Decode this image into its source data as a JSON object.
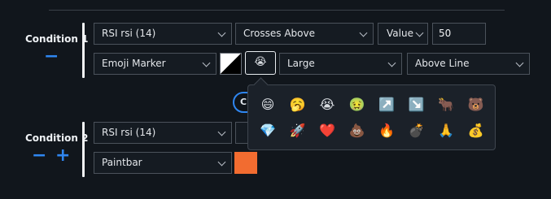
{
  "conditions": [
    {
      "label": "Condition 1",
      "ops": [
        "−"
      ],
      "indicator": "RSI rsi (14)",
      "operator": "Crosses Above",
      "value_type": "Value",
      "value": "50",
      "marker_type": "Emoji Marker",
      "selected_emoji": "😭",
      "size": "Large",
      "position": "Above Line"
    },
    {
      "label": "Condition 2",
      "ops": [
        "−",
        "+"
      ],
      "indicator": "RSI rsi (14)",
      "marker_type": "Paintbar",
      "paint_color": "#f26c30"
    }
  ],
  "hidden_pill_text": "C",
  "emoji_picker": {
    "row1": [
      "😄",
      "🥱",
      "😭",
      "🤢",
      "↗️",
      "↘️",
      "🐂",
      "🐻"
    ],
    "row2": [
      "💎",
      "🚀",
      "❤️",
      "💩",
      "🔥",
      "💣",
      "🙏",
      "💰"
    ]
  },
  "colors": {
    "background": "#11161c",
    "accent": "#2f86f0",
    "paint": "#f26c30"
  }
}
